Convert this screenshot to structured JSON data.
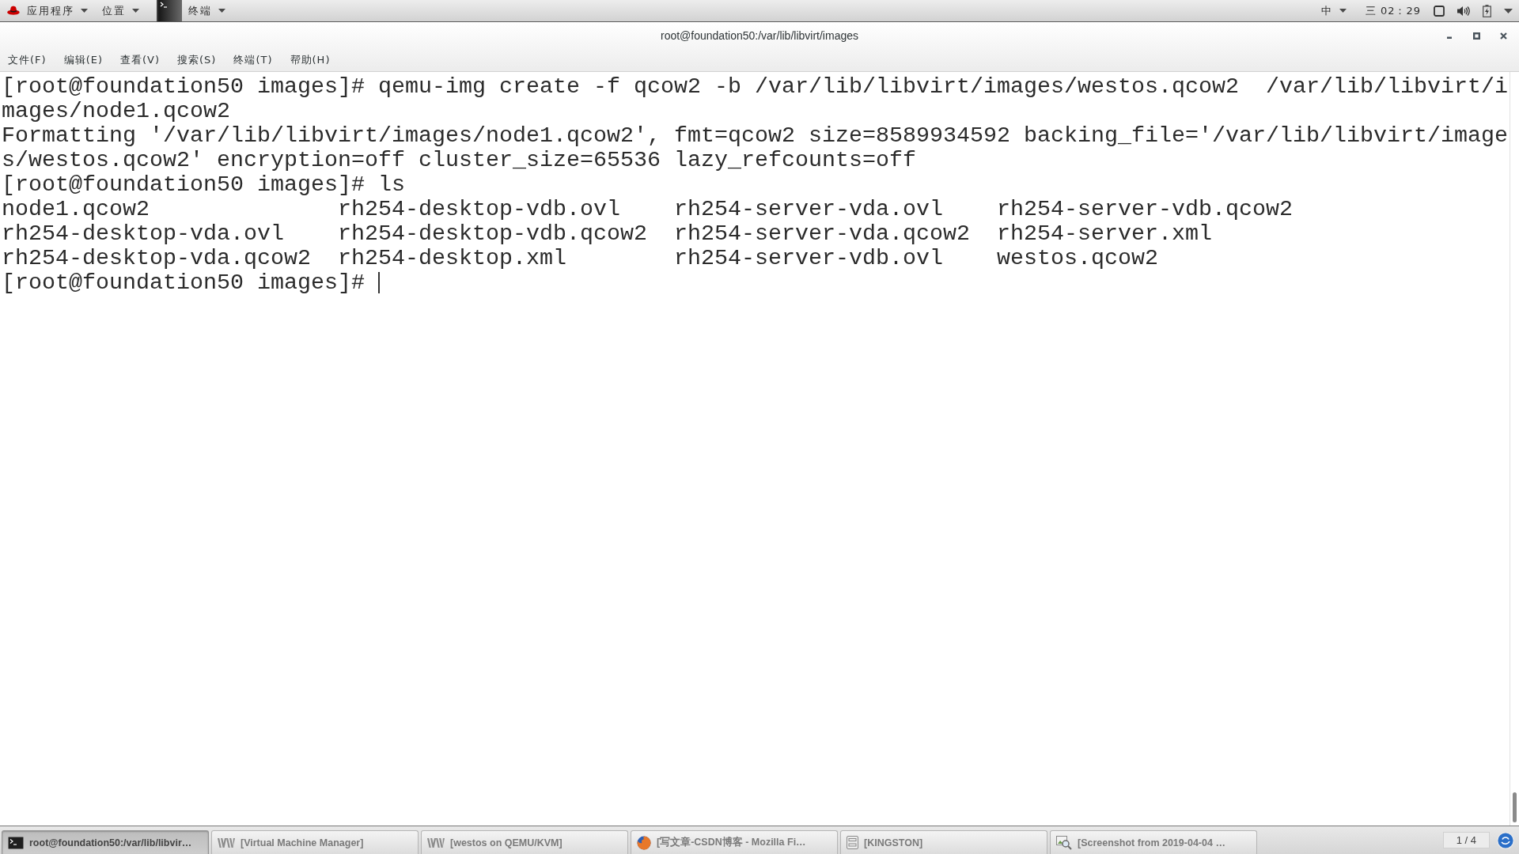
{
  "top_bar": {
    "menus": [
      {
        "kind": "logo",
        "label": "应用程序"
      },
      {
        "kind": "plain",
        "label": "位置"
      },
      {
        "kind": "app",
        "label": "终端"
      }
    ],
    "input_method": "中",
    "clock": "三 02：29"
  },
  "window": {
    "title": "root@foundation50:/var/lib/libvirt/images"
  },
  "menu_bar": [
    "文件(F)",
    "编辑(E)",
    "查看(V)",
    "搜索(S)",
    "终端(T)",
    "帮助(H)"
  ],
  "terminal": {
    "lines": [
      {
        "kind": "command",
        "text": "[root@foundation50 images]# qemu-img create -f qcow2 -b /var/lib/libvirt/images/westos.qcow2  /var/lib/libvirt/images/node1.qcow2",
        "cursor": false
      },
      {
        "kind": "output",
        "text": "Formatting '/var/lib/libvirt/images/node1.qcow2', fmt=qcow2 size=8589934592 backing_file='/var/lib/libvirt/images/westos.qcow2' encryption=off cluster_size=65536 lazy_refcounts=off",
        "cursor": false
      },
      {
        "kind": "command",
        "text": "[root@foundation50 images]# ls",
        "cursor": false
      },
      {
        "kind": "listing",
        "rows": [
          [
            "node1.qcow2",
            "rh254-desktop-vdb.ovl",
            "rh254-server-vda.ovl",
            "rh254-server-vdb.qcow2"
          ],
          [
            "rh254-desktop-vda.ovl",
            "rh254-desktop-vdb.qcow2",
            "rh254-server-vda.qcow2",
            "rh254-server.xml"
          ],
          [
            "rh254-desktop-vda.qcow2",
            "rh254-desktop.xml",
            "rh254-server-vdb.ovl",
            "westos.qcow2"
          ]
        ]
      },
      {
        "kind": "command",
        "text": "[root@foundation50 images]#",
        "cursor": true
      }
    ]
  },
  "taskbar": {
    "tasks": [
      {
        "kind": "terminal",
        "label": "root@foundation50:/var/lib/libvir…",
        "selected": true
      },
      {
        "kind": "virt",
        "label": "[Virtual Machine Manager]",
        "selected": false
      },
      {
        "kind": "virt",
        "label": "[westos on QEMU/KVM]",
        "selected": false
      },
      {
        "kind": "browser",
        "label": "[写文章-CSDN博客 - Mozilla Fi…",
        "selected": false
      },
      {
        "kind": "drive",
        "label": "[KINGSTON]",
        "selected": false
      },
      {
        "kind": "image",
        "label": "[Screenshot from 2019-04-04 …",
        "selected": false
      }
    ],
    "workspace": "1 / 4"
  }
}
